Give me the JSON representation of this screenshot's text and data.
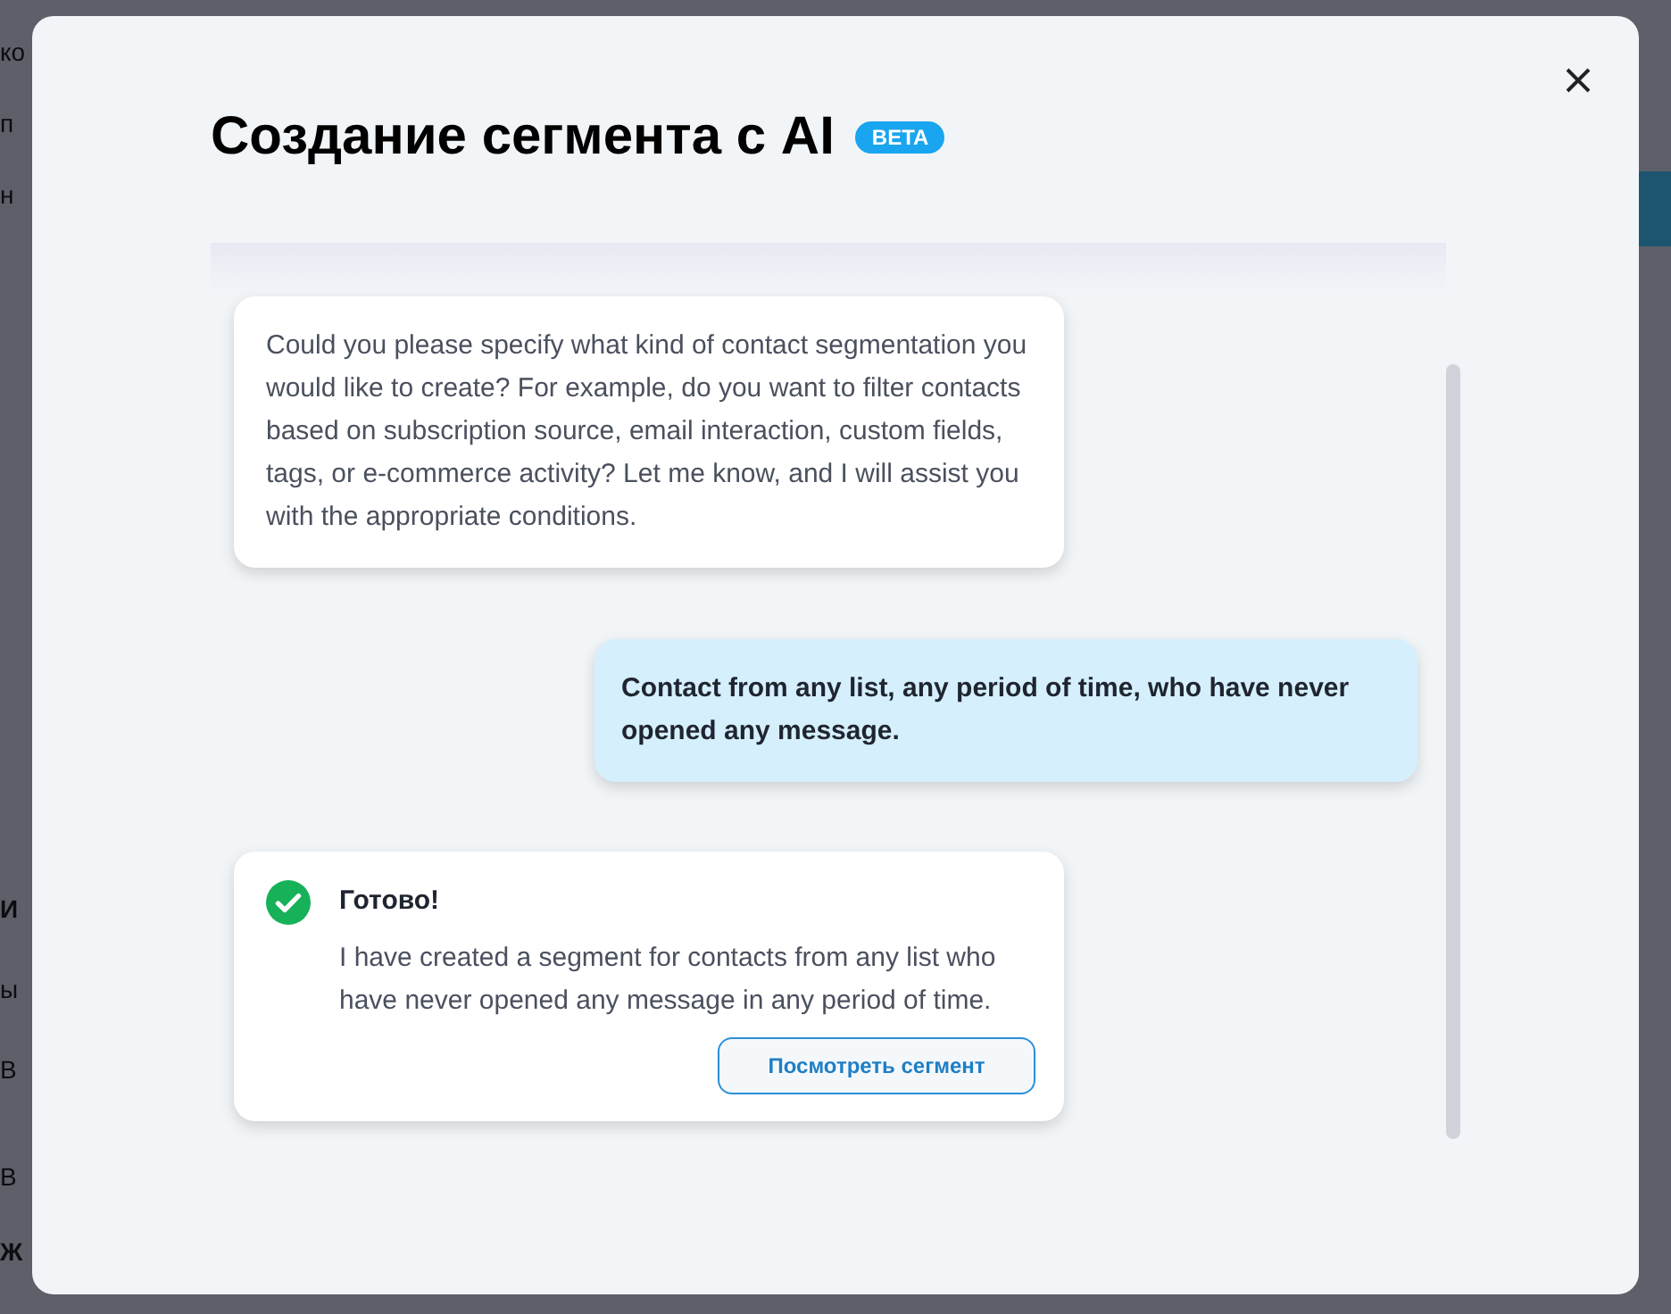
{
  "background_page": {
    "side_fragments": [
      "ко",
      "п",
      "н",
      "И",
      "ы",
      "В",
      "В",
      "Ж"
    ]
  },
  "modal": {
    "title": "Создание сегмента с AI",
    "badge": "BETA",
    "messages": [
      {
        "kind": "bot",
        "text": "Could you please specify what kind of contact segmentation you would like to create? For example, do you want to filter contacts based on subscription source, email interaction, custom fields, tags, or e-commerce activity? Let me know, and I will assist you with the appropriate conditions."
      },
      {
        "kind": "user",
        "text": "Contact from any list, any period of time, who have never opened any message."
      },
      {
        "kind": "result",
        "title": "Готово!",
        "text": "I have created a segment for contacts from any list who have never opened any message in any period of time.",
        "button": "Посмотреть сегмент"
      }
    ]
  }
}
